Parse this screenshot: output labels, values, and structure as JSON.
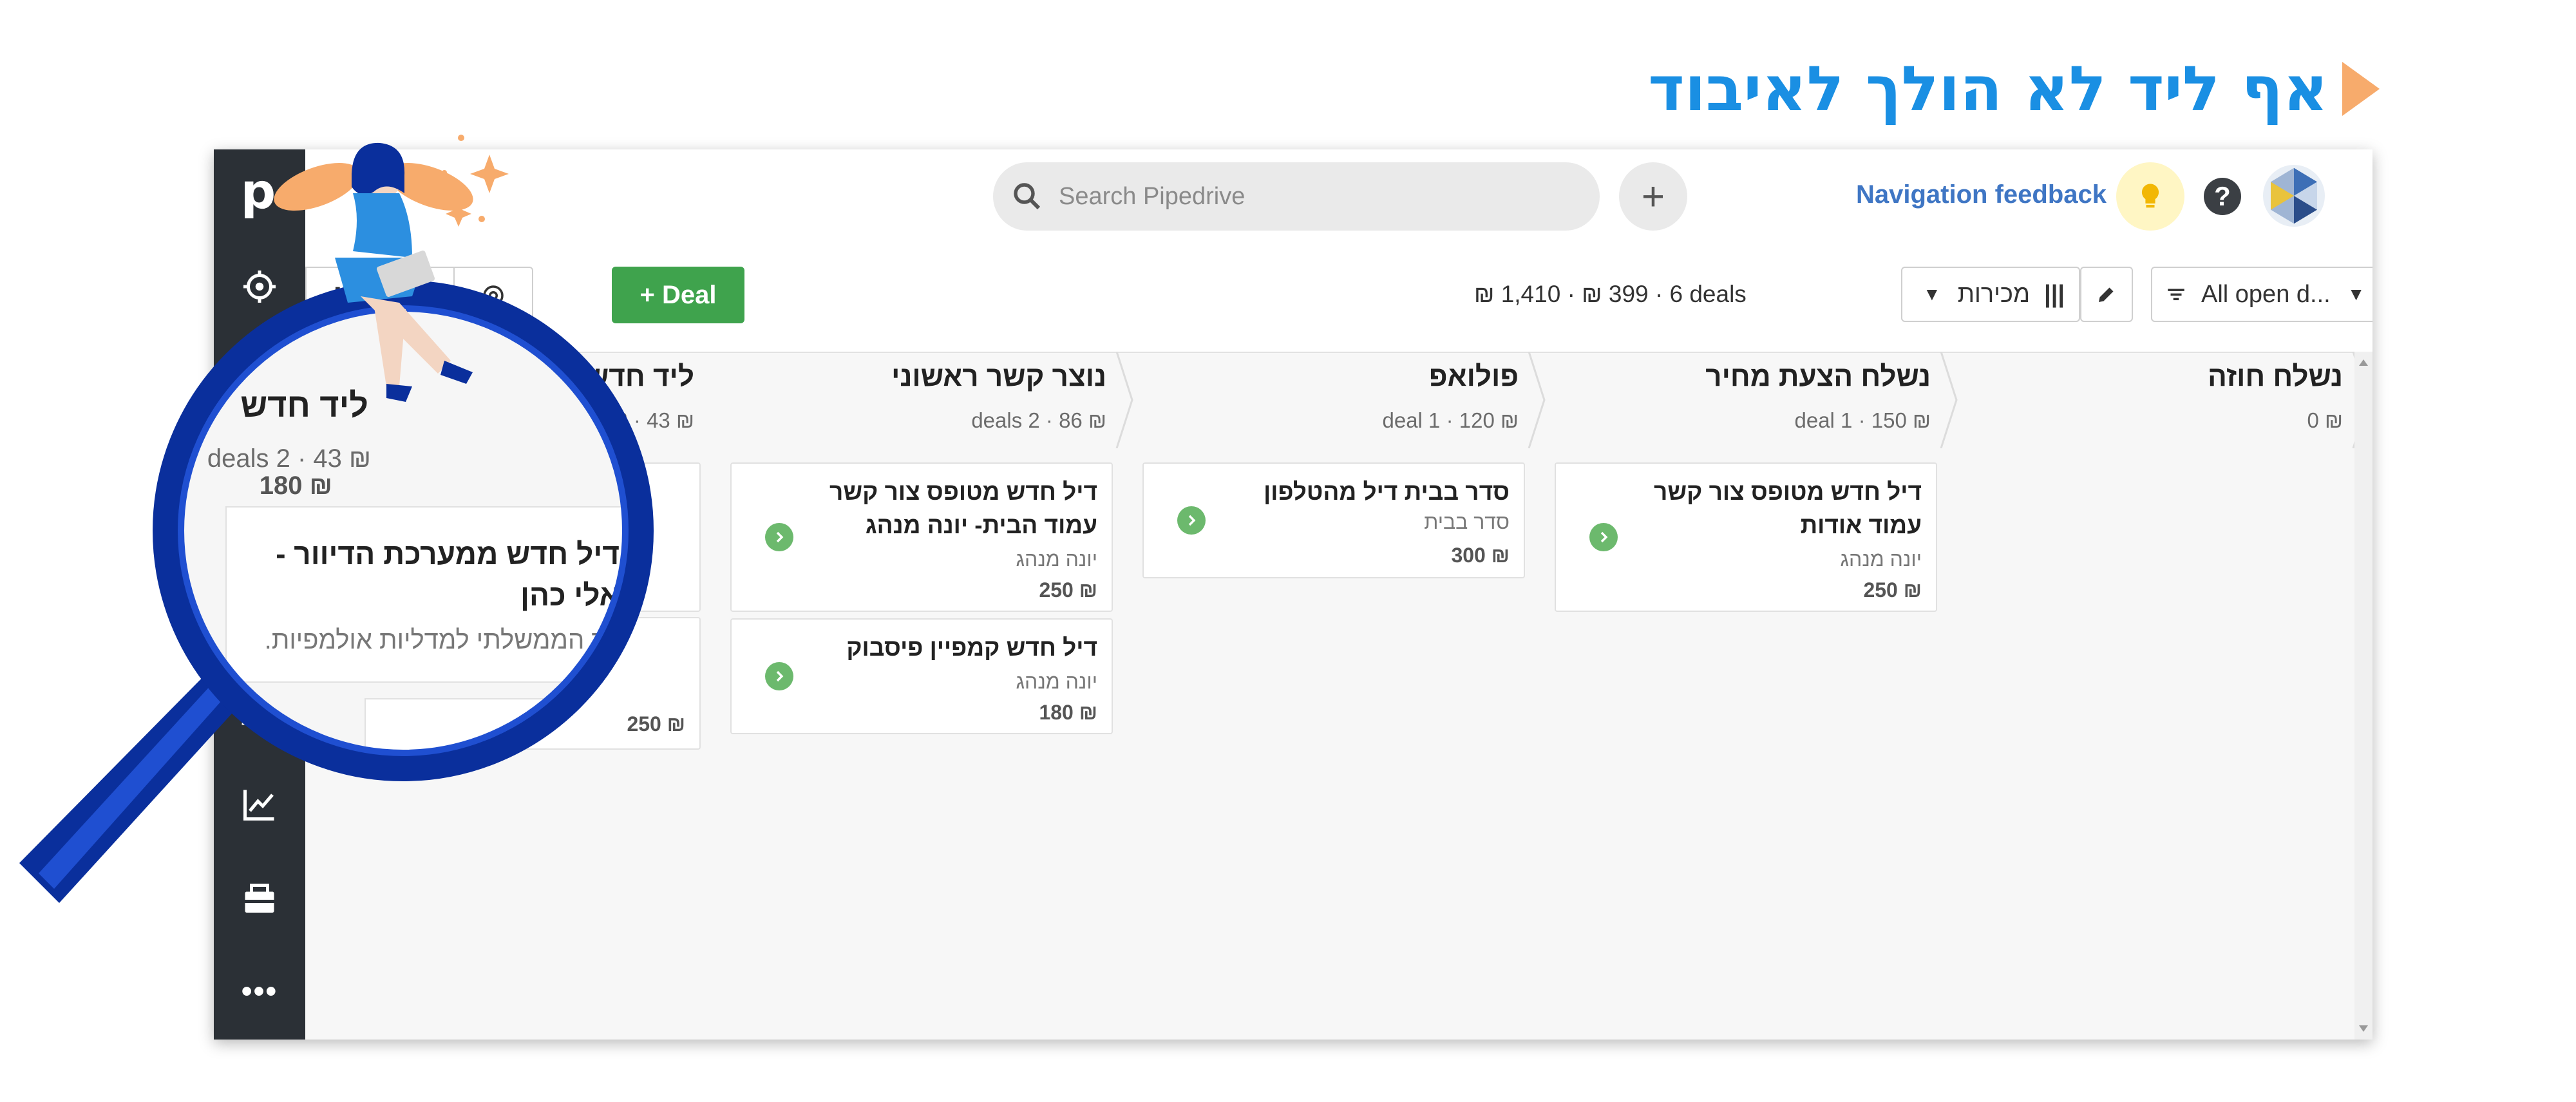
{
  "heading": "אף ליד לא הולך לאיבוד",
  "app": {
    "logo": "p",
    "search_placeholder": "Search Pipedrive",
    "nav_feedback": "Navigation feedback",
    "help": "?",
    "add_deal": "+ Deal",
    "summary": "₪ 1,410 · ₪ 399 · 6 deals",
    "pipeline": "מכירות",
    "filter": "All open d...",
    "more": "•••"
  },
  "stages": [
    {
      "name": "ליד חדש",
      "meta": "₪ 43 · 2 deals"
    },
    {
      "name": "נוצר קשר ראשוני",
      "meta": "₪ 86 · 2 deals"
    },
    {
      "name": "פולואפ",
      "meta": "₪ 120 · 1 deal"
    },
    {
      "name": "נשלח הצעת מחיר",
      "meta": "₪ 150 · 1 deal"
    },
    {
      "name": "נשלח חוזה",
      "meta": "₪ 0"
    }
  ],
  "cards": [
    {
      "title": "דיל חדש ממערכת הדיוור - אלי כהן",
      "person": "רד הממשלתי למדליות אולמפיות",
      "value": "₪ 180"
    },
    {
      "title": "",
      "person": "",
      "value": "₪ 250"
    },
    {
      "title": "דיל חדש מטופס צור קשר עמוד הבית- יונה מנהג",
      "person": "יונה מנהג",
      "value": "₪ 250"
    },
    {
      "title": "דיל חדש קמפיין פיסבוק",
      "person": "יונה מנהג",
      "value": "₪ 180"
    },
    {
      "title": "סדר בבית דיל מהטלפון",
      "person": "סדר בבית",
      "value": "₪ 300"
    },
    {
      "title": "דיל חדש מטופס צור קשר עמוד אודות",
      "person": "יונה מנהג",
      "value": "₪ 250"
    }
  ],
  "zoom": {
    "stage_name": "ליד חדש",
    "stage_meta": "₪ 43 · 2 deals",
    "card_title": "דיל חדש ממערכת הדיוור - אלי כהן",
    "card_org": "רד הממשלתי למדליות אולמפיות.",
    "card_value": "₪ 180",
    "card2_value": "₪ 250"
  },
  "colors": {
    "heading": "#1a8fe3",
    "heading_arrow": "#f7ab6c",
    "sidebar": "#2b3036",
    "deal_button": "#3fa34d",
    "go_icon": "#6cb96d",
    "magnifier": "#0a2f9c",
    "nav_feedback": "#3f76c4"
  }
}
